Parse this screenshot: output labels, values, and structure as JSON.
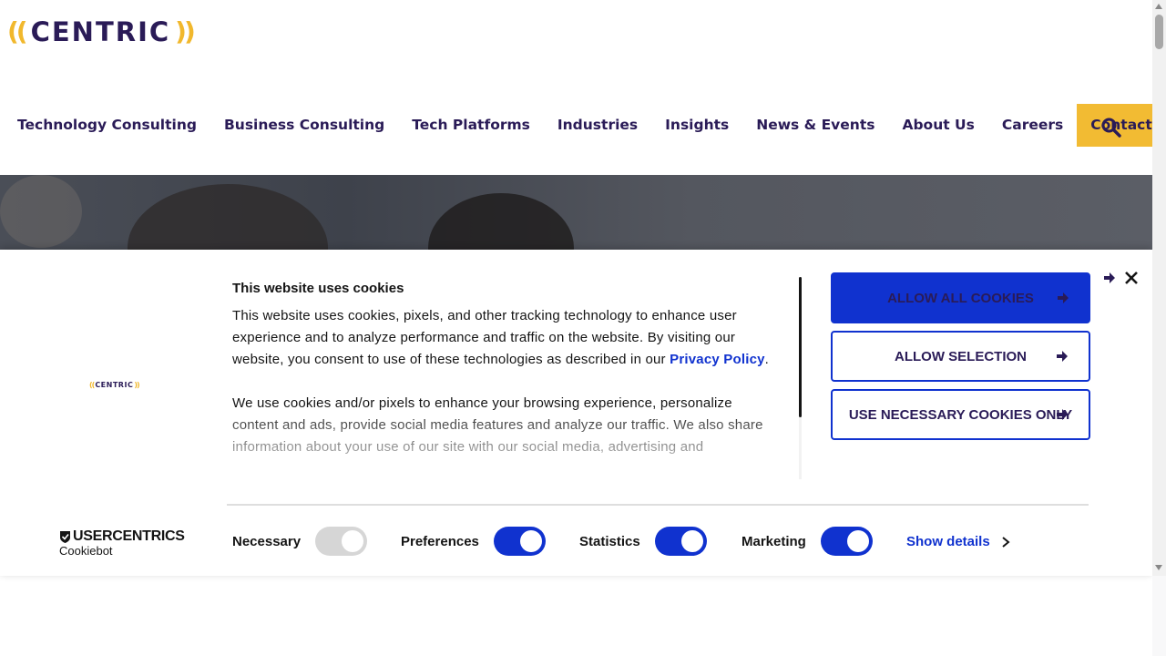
{
  "header": {
    "logo": {
      "left_paren": "((",
      "word": "CENTRIC",
      "right_paren": "))"
    },
    "nav": [
      {
        "label": "Technology Consulting"
      },
      {
        "label": "Business Consulting"
      },
      {
        "label": "Tech Platforms"
      },
      {
        "label": "Industries"
      },
      {
        "label": "Insights"
      },
      {
        "label": "News & Events"
      },
      {
        "label": "About Us"
      },
      {
        "label": "Careers"
      },
      {
        "label": "Contact Us"
      }
    ],
    "search_icon": "search-icon"
  },
  "cookie_banner": {
    "logo": {
      "left_paren": "((",
      "word": "CENTRIC",
      "right_paren": "))"
    },
    "title": "This website uses cookies",
    "paragraph1_pre": "This website uses cookies, pixels, and other tracking technology to enhance user experience and to analyze performance and traffic on the website. By visiting our website, you consent to use of these technologies as described in our ",
    "privacy_link": "Privacy Policy",
    "paragraph1_post": ".",
    "paragraph2": "We use cookies and/or pixels to enhance your browsing experience, personalize content and ads, provide social media features and analyze our traffic. We also share information about your use of our site with our social media, advertising and",
    "buttons": {
      "allow_all": "ALLOW ALL COOKIES",
      "allow_selection": "ALLOW SELECTION",
      "necessary_only": "USE NECESSARY COOKIES ONLY"
    },
    "toggles": {
      "necessary": {
        "label": "Necessary",
        "enabled": true,
        "locked": true
      },
      "preferences": {
        "label": "Preferences",
        "enabled": true
      },
      "statistics": {
        "label": "Statistics",
        "enabled": true
      },
      "marketing": {
        "label": "Marketing",
        "enabled": true
      }
    },
    "show_details": "Show details",
    "provider": {
      "brand": "USERCENTRICS",
      "product": "Cookiebot"
    }
  },
  "colors": {
    "brand_navy": "#2a1b57",
    "brand_gold": "#f2bb33",
    "cookie_blue": "#1032cf"
  }
}
